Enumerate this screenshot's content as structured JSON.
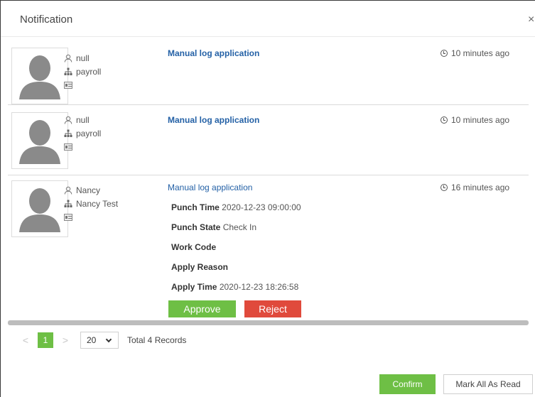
{
  "dialog": {
    "title": "Notification",
    "close_symbol": "×"
  },
  "notifications": [
    {
      "user": "null",
      "department": "payroll",
      "subject": "Manual log application",
      "time": "10 minutes ago"
    },
    {
      "user": "null",
      "department": "payroll",
      "subject": "Manual log application",
      "time": "10 minutes ago"
    },
    {
      "user": "Nancy",
      "department": "Nancy Test",
      "subject": "Manual log application",
      "time": "16 minutes ago",
      "details": {
        "punch_time_label": "Punch Time",
        "punch_time": "2020-12-23 09:00:00",
        "punch_state_label": "Punch State",
        "punch_state": "Check In",
        "work_code_label": "Work Code",
        "apply_reason_label": "Apply Reason",
        "apply_time_label": "Apply Time",
        "apply_time": "2020-12-23 18:26:58"
      },
      "approve_label": "Approve",
      "reject_label": "Reject"
    }
  ],
  "pagination": {
    "prev_symbol": "<",
    "current_page": "1",
    "next_symbol": ">",
    "page_size": "20",
    "total": "Total 4 Records"
  },
  "footer": {
    "confirm_label": "Confirm",
    "mark_all_label": "Mark All As Read"
  },
  "colors": {
    "accent_green": "#6ebf45",
    "danger_red": "#e04a3c",
    "link_blue": "#2461a6"
  },
  "icons": [
    "user-icon",
    "department-icon",
    "id-card-icon",
    "clock-icon",
    "chevron-down-icon",
    "close-icon"
  ]
}
